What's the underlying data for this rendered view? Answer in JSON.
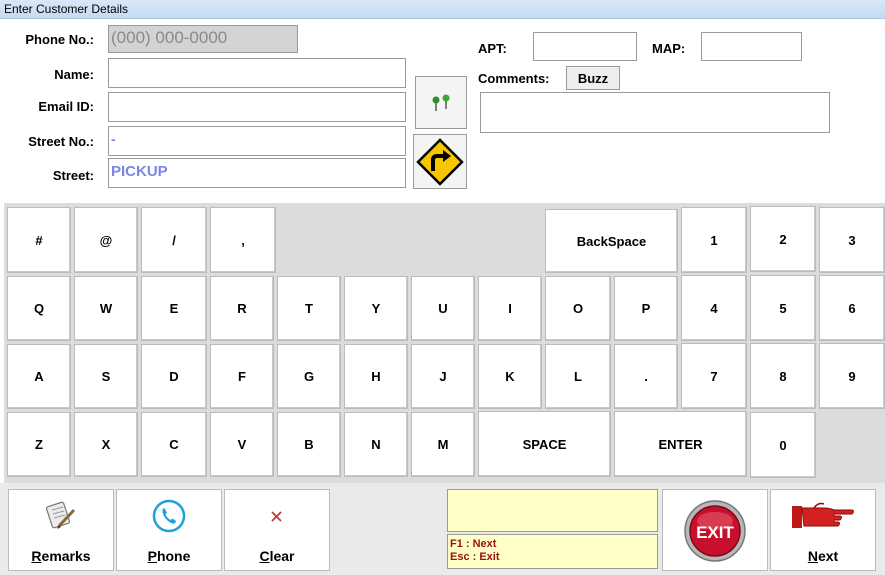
{
  "window": {
    "title": "Enter Customer Details"
  },
  "form": {
    "phone_label": "Phone No.:",
    "phone_value": "(000) 000-0000",
    "name_label": "Name:",
    "name_value": "",
    "email_label": "Email ID:",
    "email_value": "",
    "street_no_label": "Street No.:",
    "street_no_value": "-",
    "street_label": "Street:",
    "street_value": "PICKUP",
    "apt_label": "APT:",
    "apt_value": "",
    "map_label": "MAP:",
    "map_value": "",
    "comments_label": "Comments:",
    "comments_value": "",
    "buzz_label": "Buzz"
  },
  "keyboard": {
    "rows": [
      [
        "#",
        "@",
        "/",
        ","
      ],
      [
        "Q",
        "W",
        "E",
        "R",
        "T",
        "Y",
        "U",
        "I",
        "O",
        "P"
      ],
      [
        "A",
        "S",
        "D",
        "F",
        "G",
        "H",
        "J",
        "K",
        "L",
        "."
      ],
      [
        "Z",
        "X",
        "C",
        "V",
        "B",
        "N",
        "M"
      ]
    ],
    "backspace": "BackSpace",
    "space": "SPACE",
    "enter": "ENTER",
    "numpad": [
      "1",
      "2",
      "3",
      "4",
      "5",
      "6",
      "7",
      "8",
      "9",
      "0"
    ]
  },
  "footer": {
    "remarks_label": "Remarks",
    "phone_label": "Phone",
    "clear_label": "Clear",
    "next_label": "Next",
    "exit_label": "EXIT",
    "hint_f1": "F1 : Next",
    "hint_esc": "Esc : Exit",
    "status_text": ""
  },
  "colors": {
    "accent_text": "#7b84e8",
    "hint_text": "#9a1010",
    "status_bg": "#ffffc8",
    "exit_red": "#c8102e"
  },
  "icons": [
    "map-pins-icon",
    "turn-right-sign-icon",
    "remarks-icon",
    "phone-icon",
    "clear-x-icon",
    "exit-icon",
    "pointing-hand-icon"
  ]
}
